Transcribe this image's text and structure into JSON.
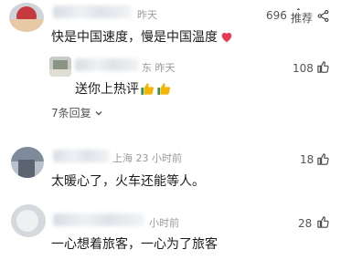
{
  "comments": [
    {
      "time_suffix": "昨天",
      "text": "快是中国速度，慢是中国温度",
      "likes": "696",
      "actions": {
        "recommend": "推荐"
      }
    },
    {
      "reply": true,
      "time_suffix": "东 昨天",
      "text": "送你上热评",
      "likes": "108"
    },
    {
      "replies_link": "7条回复"
    },
    {
      "time_suffix": "上海 23 小时前",
      "text": "太暖心了，火车还能等人。",
      "likes": "18"
    },
    {
      "time_suffix": "小时前",
      "text": "一心想着旅客，一心为了旅客",
      "likes": "28"
    }
  ],
  "icons": {
    "like": "thumb-up-outline-icon",
    "share": "share-icon",
    "emoji_heart": "red-heart-icon",
    "emoji_thumb": "thumbs-up-emoji-icon",
    "chevron": "chevron-down-icon"
  },
  "colors": {
    "background": "#ffffff",
    "text": "#1c1c1c",
    "meta": "#9a9a9a",
    "heart": "#e83a54",
    "thumb": "#f5b400"
  }
}
